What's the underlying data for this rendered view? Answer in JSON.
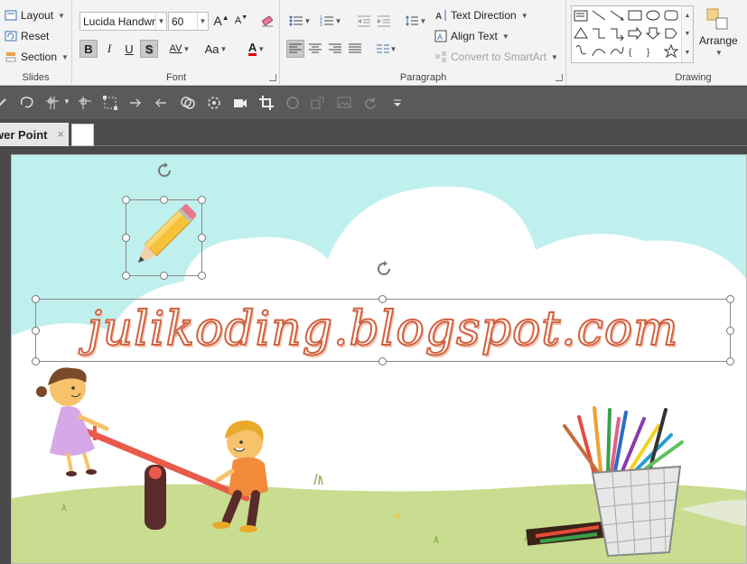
{
  "ribbon": {
    "slides_group": {
      "label": "Slides",
      "layout": "Layout",
      "reset": "Reset",
      "section": "Section"
    },
    "font_group": {
      "label": "Font",
      "font_name": "Lucida Handwr",
      "font_size": "60",
      "bold": "B",
      "italic": "I",
      "underline": "U",
      "shadow": "S",
      "spacing": "AV",
      "change_case": "Aa",
      "font_color_letter": "A",
      "grow": "A",
      "shrink": "A"
    },
    "paragraph_group": {
      "label": "Paragraph",
      "text_direction": "Text Direction",
      "align_text": "Align Text",
      "convert_smartart": "Convert to SmartArt"
    },
    "drawing_group": {
      "label": "Drawing",
      "arrange": "Arrange"
    }
  },
  "tabs": {
    "document_tab": "wer Point",
    "close_glyph": "×"
  },
  "slide": {
    "text": "julikoding.blogspot.com"
  },
  "colors": {
    "sky": "#bff0ee",
    "grass": "#c9dc8f",
    "text_outline": "#d2613f",
    "seesaw": "#e85a4a"
  }
}
